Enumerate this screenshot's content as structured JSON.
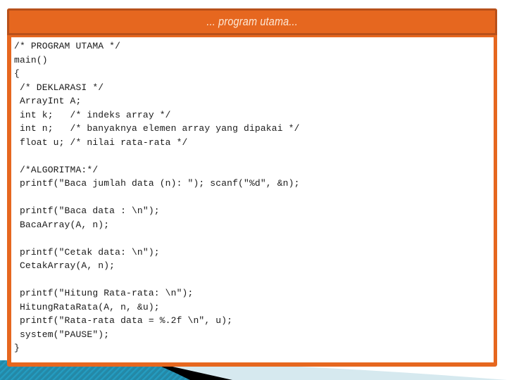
{
  "slide": {
    "title": "... program utama...",
    "colors": {
      "frame": "#e6671f",
      "frame_dark": "#b8501a",
      "title_text": "#fde8d6",
      "panel": "#ffffff",
      "code_text": "#1a1a1a",
      "wave_teal": "#1a86a6",
      "wave_light": "#d6e9ef",
      "wave_dark": "#000000"
    }
  },
  "code": {
    "lines": [
      "/* PROGRAM UTAMA */",
      "main()",
      "{",
      " /* DEKLARASI */",
      " ArrayInt A;",
      " int k;   /* indeks array */",
      " int n;   /* banyaknya elemen array yang dipakai */",
      " float u; /* nilai rata-rata */",
      "",
      " /*ALGORITMA:*/",
      " printf(\"Baca jumlah data (n): \"); scanf(\"%d\", &n);",
      "",
      " printf(\"Baca data : \\n\");",
      " BacaArray(A, n);",
      "",
      " printf(\"Cetak data: \\n\");",
      " CetakArray(A, n);",
      "",
      " printf(\"Hitung Rata-rata: \\n\");",
      " HitungRataRata(A, n, &u);",
      " printf(\"Rata-rata data = %.2f \\n\", u);",
      " system(\"PAUSE\");",
      "}"
    ]
  }
}
